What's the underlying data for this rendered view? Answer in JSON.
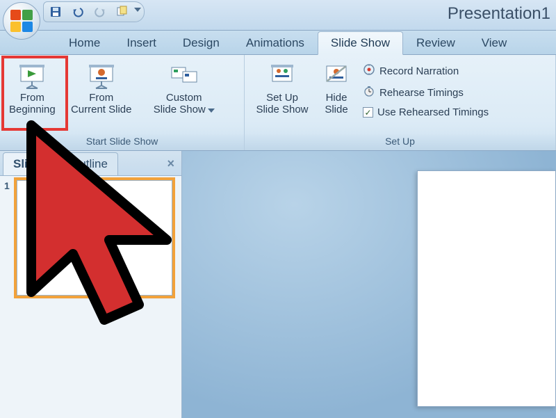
{
  "title": "Presentation1",
  "qat": {
    "save": "save-icon",
    "undo": "undo-icon",
    "redo": "redo-icon",
    "layout": "quick-layout-icon"
  },
  "tabs": {
    "home": "Home",
    "insert": "Insert",
    "design": "Design",
    "animations": "Animations",
    "slideshow": "Slide Show",
    "review": "Review",
    "view": "View"
  },
  "active_tab": "slideshow",
  "ribbon": {
    "start_group_label": "Start Slide Show",
    "setup_group_label": "Set Up",
    "from_beginning_l1": "From",
    "from_beginning_l2": "Beginning",
    "from_current_l1": "From",
    "from_current_l2": "Current Slide",
    "custom_l1": "Custom",
    "custom_l2": "Slide Show",
    "setup_l1": "Set Up",
    "setup_l2": "Slide Show",
    "hide_l1": "Hide",
    "hide_l2": "Slide",
    "record_narration": "Record Narration",
    "rehearse_timings": "Rehearse Timings",
    "use_rehearsed": "Use Rehearsed Timings",
    "use_rehearsed_checked": true
  },
  "panel": {
    "tab_slides": "Slides",
    "tab_outline": "Outline",
    "close": "×",
    "thumb1_num": "1"
  }
}
